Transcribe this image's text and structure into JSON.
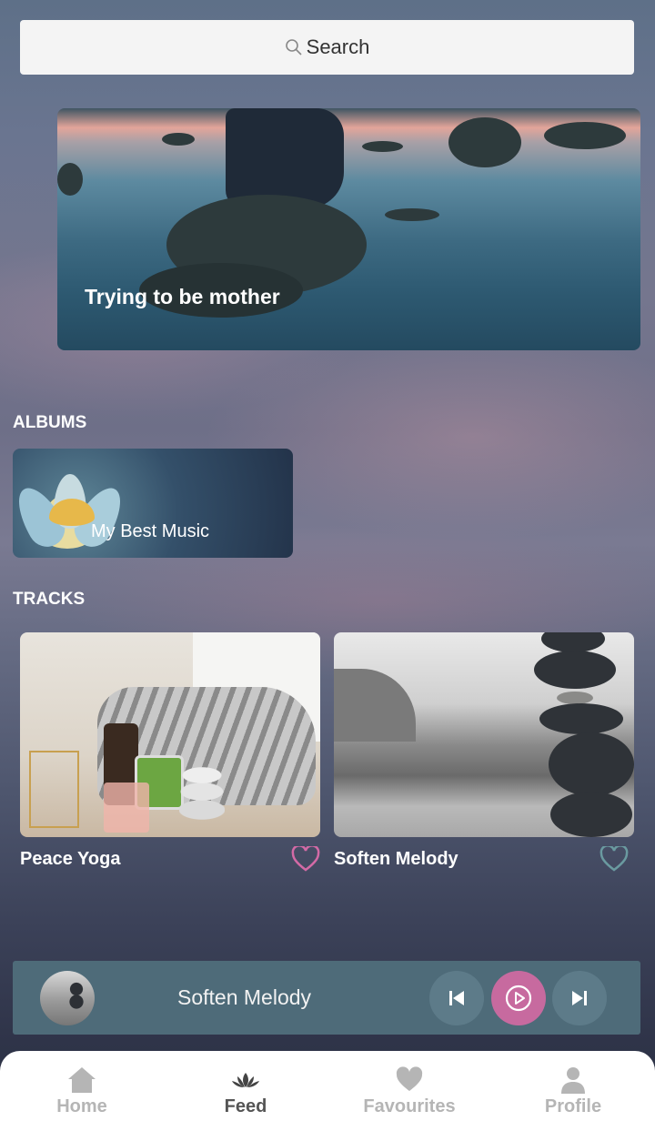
{
  "search": {
    "label": "Search"
  },
  "hero": {
    "title": "Trying to be mother"
  },
  "albums": {
    "heading": "ALBUMS",
    "items": [
      {
        "title": "My Best Music"
      }
    ]
  },
  "tracks": {
    "heading": "TRACKS",
    "items": [
      {
        "title": "Peace Yoga",
        "favourite": true,
        "heart_color": "#d36aa6"
      },
      {
        "title": "Soften Melody",
        "favourite": false,
        "heart_color": "#6a9aa0"
      }
    ]
  },
  "player": {
    "title": "Soften Melody",
    "accent": "#c76a9f",
    "controls": [
      "previous-icon",
      "play-icon",
      "next-icon"
    ]
  },
  "nav": {
    "items": [
      {
        "label": "Home",
        "icon": "home-icon",
        "active": false
      },
      {
        "label": "Feed",
        "icon": "lotus-icon",
        "active": true
      },
      {
        "label": "Favourites",
        "icon": "heart-icon",
        "active": false
      },
      {
        "label": "Profile",
        "icon": "user-icon",
        "active": false
      }
    ]
  }
}
